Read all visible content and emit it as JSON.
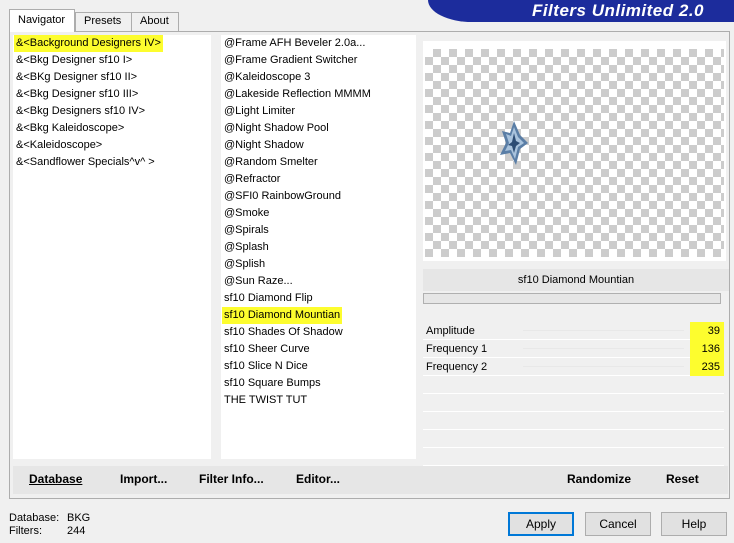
{
  "app": {
    "title": "Filters Unlimited 2.0"
  },
  "tabs": [
    {
      "label": "Navigator",
      "active": true
    },
    {
      "label": "Presets",
      "active": false
    },
    {
      "label": "About",
      "active": false
    }
  ],
  "categories": [
    {
      "label": "&<Background Designers IV>",
      "selected": true
    },
    {
      "label": "&<Bkg Designer sf10 I>"
    },
    {
      "label": "&<BKg Designer sf10 II>"
    },
    {
      "label": "&<Bkg Designer sf10 III>"
    },
    {
      "label": "&<Bkg Designers sf10 IV>"
    },
    {
      "label": "&<Bkg Kaleidoscope>"
    },
    {
      "label": "&<Kaleidoscope>"
    },
    {
      "label": "&<Sandflower Specials^v^ >"
    }
  ],
  "filters": [
    {
      "label": "@Frame AFH Beveler 2.0a..."
    },
    {
      "label": "@Frame Gradient Switcher"
    },
    {
      "label": "@Kaleidoscope 3"
    },
    {
      "label": "@Lakeside Reflection MMMM"
    },
    {
      "label": "@Light Limiter"
    },
    {
      "label": "@Night Shadow Pool"
    },
    {
      "label": "@Night Shadow"
    },
    {
      "label": "@Random Smelter"
    },
    {
      "label": "@Refractor"
    },
    {
      "label": "@SFI0 RainbowGround"
    },
    {
      "label": "@Smoke"
    },
    {
      "label": "@Spirals"
    },
    {
      "label": "@Splash"
    },
    {
      "label": "@Splish"
    },
    {
      "label": "@Sun Raze..."
    },
    {
      "label": "sf10 Diamond Flip"
    },
    {
      "label": "sf10 Diamond Mountian",
      "selected": true
    },
    {
      "label": "sf10 Shades Of Shadow"
    },
    {
      "label": "sf10 Sheer Curve"
    },
    {
      "label": "sf10 Slice N Dice"
    },
    {
      "label": "sf10 Square Bumps"
    },
    {
      "label": "THE TWIST TUT"
    }
  ],
  "selected_filter": {
    "name": "sf10 Diamond Mountian"
  },
  "params": [
    {
      "label": "Amplitude",
      "value": "39"
    },
    {
      "label": "Frequency 1",
      "value": "136"
    },
    {
      "label": "Frequency 2",
      "value": "235"
    }
  ],
  "bottom_buttons": {
    "database": "Database",
    "import": "Import...",
    "filter_info": "Filter Info...",
    "editor": "Editor...",
    "randomize": "Randomize",
    "reset": "Reset"
  },
  "footer": {
    "database_label": "Database:",
    "database_value": "BKG",
    "filters_label": "Filters:",
    "filters_value": "244",
    "apply": "Apply",
    "cancel": "Cancel",
    "help": "Help"
  },
  "colors": {
    "banner": "#1c2c9c",
    "highlight": "#fdfd2e"
  }
}
